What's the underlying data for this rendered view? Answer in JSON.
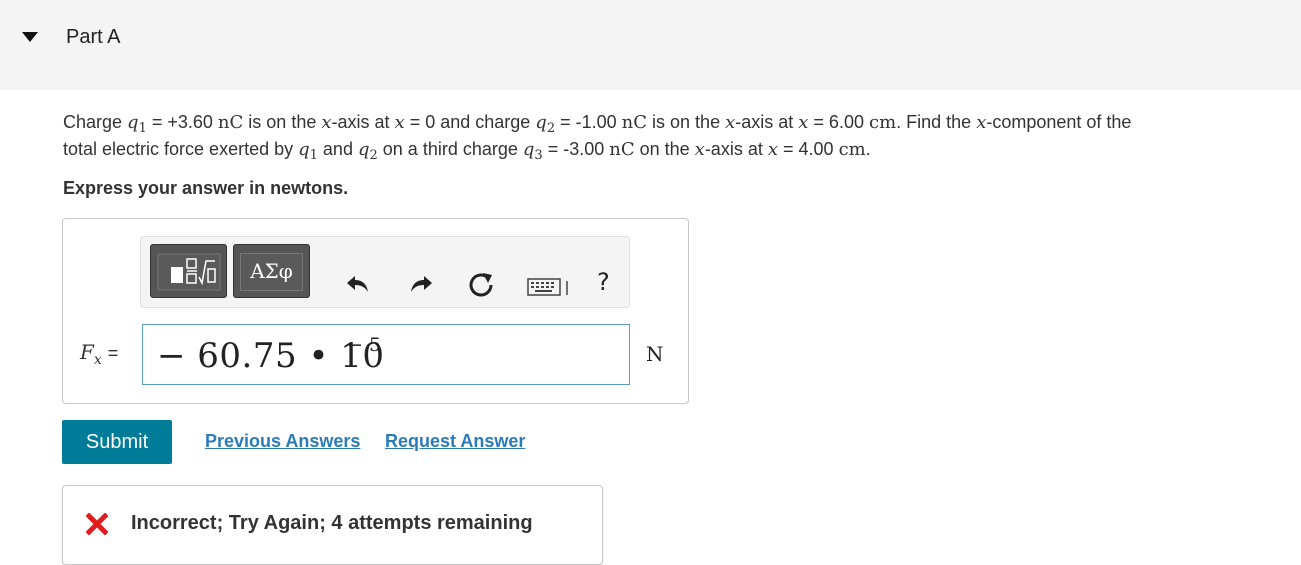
{
  "part": {
    "title": "Part A"
  },
  "question": {
    "t1": "Charge ",
    "q1_var": "q",
    "q1_sub": "1",
    "t2": " = +3.60 ",
    "unit_nC_1": "nC",
    "t3": " is on the ",
    "x1": "x",
    "t4": "-axis at ",
    "x2": "x",
    "t5": " = 0 and charge ",
    "q2_var": "q",
    "q2_sub": "2",
    "t6": " = -1.00 ",
    "unit_nC_2": "nC",
    "t7": " is on the ",
    "x3": "x",
    "t8": "-axis at ",
    "x4": "x",
    "t9": " = 6.00 ",
    "unit_cm_1": "cm",
    "t10": ". Find the ",
    "x5": "x",
    "t11": "-component of the",
    "t12": "total electric force exerted by ",
    "q1b_var": "q",
    "q1b_sub": "1",
    "t13": " and ",
    "q2b_var": "q",
    "q2b_sub": "2",
    "t14": " on a third charge ",
    "q3_var": "q",
    "q3_sub": "3",
    "t15": " = -3.00 ",
    "unit_nC_3": "nC",
    "t16": " on the ",
    "x6": "x",
    "t17": "-axis at ",
    "x7": "x",
    "t18": " = 4.00 ",
    "unit_cm_2": "cm",
    "t19": "."
  },
  "instruction": "Express your answer in newtons.",
  "toolbar": {
    "greek_label": "ΑΣφ",
    "help_label": "?",
    "icons": [
      "templates-icon",
      "greek-letters-icon",
      "undo-icon",
      "redo-icon",
      "reset-icon",
      "keyboard-icon",
      "help-icon"
    ]
  },
  "answer": {
    "label_var": "F",
    "label_sub": "x",
    "label_eq": "=",
    "value": "− 60.75 • 10",
    "exponent": "− 5",
    "unit": "N"
  },
  "actions": {
    "submit": "Submit",
    "previous_answers": "Previous Answers",
    "request_answer": "Request Answer"
  },
  "feedback": {
    "message": "Incorrect; Try Again; 4 attempts remaining",
    "icon_color": "#e01c1c"
  },
  "colors": {
    "submit_bg": "#007c99",
    "link": "#2b7bb9",
    "header_bg": "#f4f4f4",
    "input_border": "#5a9fc0"
  }
}
